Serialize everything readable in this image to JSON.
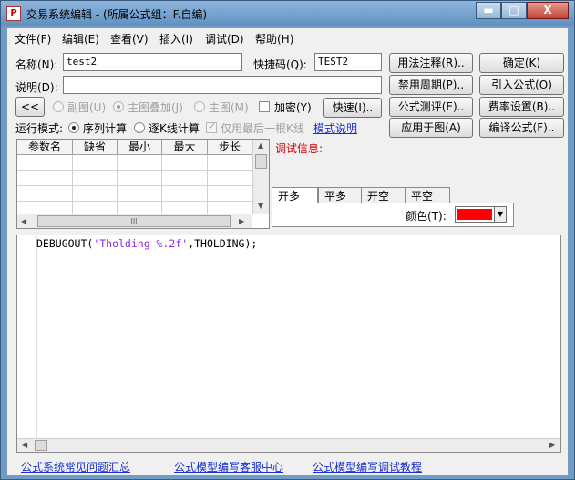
{
  "window": {
    "title": "交易系统编辑 - (所属公式组：F.自编)",
    "controls": {
      "minimize": "▬",
      "maximize": "□",
      "close": "X"
    }
  },
  "menu": [
    "文件(F)",
    "编辑(E)",
    "查看(V)",
    "插入(I)",
    "调试(D)",
    "帮助(H)"
  ],
  "form": {
    "name_label": "名称(N):",
    "name_value": "test2",
    "shortcut_label": "快捷码(Q):",
    "shortcut_value": "TEST2",
    "desc_label": "说明(D):",
    "desc_value": "",
    "collapse_button": "<<",
    "radio_subchart": "副图(U)",
    "radio_main_overlay": "主图叠加(J)",
    "radio_main": "主图(M)",
    "encrypt_label": "加密(Y)",
    "fast_button": "快速(I).."
  },
  "run_mode": {
    "label": "运行模式:",
    "sequential": "序列计算",
    "bar_by_bar": "逐K线计算",
    "last_bar_only": "仅用最后一根K线",
    "model_link": "模式说明"
  },
  "right_buttons": {
    "usage_notes": "用法注释(R)..",
    "confirm": "确定(K)",
    "disabled_periods": "禁用周期(P)..",
    "import_formula": "引入公式(O)",
    "formula_test": "公式测评(E)..",
    "fee_settings": "费率设置(B)..",
    "apply_to_chart": "应用于图(A)",
    "compile": "编译公式(F).."
  },
  "param_table": {
    "headers": [
      "参数名",
      "缺省",
      "最小",
      "最大",
      "步长"
    ],
    "rows": 4,
    "scroll_grip": "III"
  },
  "debug": {
    "label": "调试信息:",
    "tabs": [
      "开多",
      "平多",
      "开空",
      "平空"
    ],
    "color_label": "颜色(T):",
    "color_value": "#ff0000"
  },
  "editor": {
    "code_fn": "DEBUGOUT(",
    "code_str": "'Tholding %.2f'",
    "code_rest": ",THOLDING);"
  },
  "footer_links": [
    "公式系统常见问题汇总",
    "公式模型编写客服中心",
    "公式模型编写调试教程"
  ]
}
